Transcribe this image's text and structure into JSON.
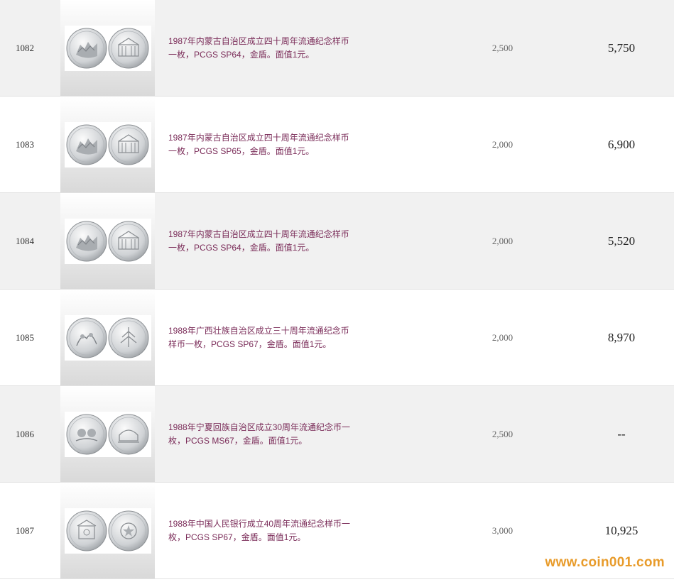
{
  "lots": [
    {
      "number": "1082",
      "desc_line1": "1987年内蒙古自治区成立四十周年流通纪念样币",
      "desc_line2": "一枚，PCGS SP64，金盾。面值1元。",
      "estimate": "2,500",
      "price": "5,750"
    },
    {
      "number": "1083",
      "desc_line1": "1987年内蒙古自治区成立四十周年流通纪念样币",
      "desc_line2": "一枚，PCGS SP65，金盾。面值1元。",
      "estimate": "2,000",
      "price": "6,900"
    },
    {
      "number": "1084",
      "desc_line1": "1987年内蒙古自治区成立四十周年流通纪念样币",
      "desc_line2": "一枚，PCGS SP64，金盾。面值1元。",
      "estimate": "2,000",
      "price": "5,520"
    },
    {
      "number": "1085",
      "desc_line1": "1988年广西壮族自治区成立三十周年流通纪念币",
      "desc_line2": "样币一枚，PCGS SP67，金盾。面值1元。",
      "estimate": "2,000",
      "price": "8,970"
    },
    {
      "number": "1086",
      "desc_line1": "1988年宁夏回族自治区成立30周年流通纪念币一",
      "desc_line2": "枚，PCGS MS67，金盾。面值1元。",
      "estimate": "2,500",
      "price": "--"
    },
    {
      "number": "1087",
      "desc_line1": "1988年中国人民银行成立40周年流通纪念样币一",
      "desc_line2": "枚，PCGS SP67，金盾。面值1元。",
      "estimate": "3,000",
      "price": "10,925"
    }
  ],
  "watermark": "www.coin001.com",
  "colors": {
    "description_text": "#7a2b58",
    "row_shade": "#f1f1f1",
    "watermark": "#e89b2a"
  }
}
